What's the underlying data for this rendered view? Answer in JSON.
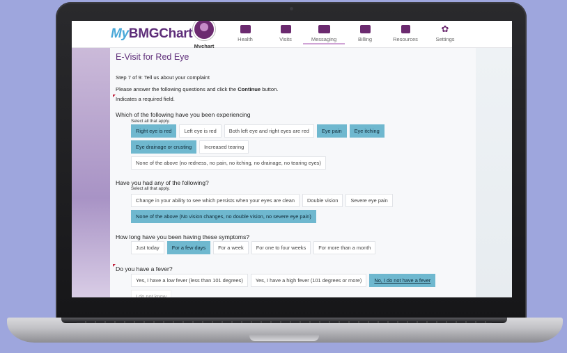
{
  "app": {
    "logo_prefix": "My",
    "logo_name": "BMGChart"
  },
  "nav": [
    {
      "label": "Mychart",
      "icon": "avatar-icon",
      "active": true
    },
    {
      "label": "Health",
      "icon": "folder-heart-icon"
    },
    {
      "label": "Visits",
      "icon": "briefcase-icon"
    },
    {
      "label": "Messaging",
      "icon": "envelope-icon"
    },
    {
      "label": "Billing",
      "icon": "credit-card-icon"
    },
    {
      "label": "Resources",
      "icon": "bookmark-plus-icon"
    },
    {
      "label": "Settings",
      "icon": "gear-icon"
    }
  ],
  "page": {
    "title": "E-Visit for Red Eye",
    "step": "Step 7 of 9: Tell us about your complaint",
    "instruction_pre": "Please answer the following questions and click the ",
    "instruction_bold": "Continue",
    "instruction_post": " button.",
    "required_note": "Indicates a required field."
  },
  "q1": {
    "question": "Which of the following have you been experiencing",
    "hint": "Select all that apply.",
    "options_row1": [
      {
        "label": "Right eye is red",
        "selected": true
      },
      {
        "label": "Left eye is red",
        "selected": false
      },
      {
        "label": "Both left eye and right eyes are red",
        "selected": false
      },
      {
        "label": "Eye pain",
        "selected": true
      },
      {
        "label": "Eye itching",
        "selected": true
      }
    ],
    "options_row2": [
      {
        "label": "Eye drainage or crusting",
        "selected": true
      },
      {
        "label": "Increased tearing",
        "selected": false
      }
    ],
    "options_row3": [
      {
        "label": "None of the above (no redness, no pain, no itching, no drainage, no tearing eyes)",
        "selected": false
      }
    ]
  },
  "q2": {
    "question": "Have you had any of the following?",
    "hint": "Select all that apply.",
    "options_row1": [
      {
        "label": "Change in your ability to see which persists when your eyes are clean",
        "selected": false
      },
      {
        "label": "Double vision",
        "selected": false
      },
      {
        "label": "Severe eye pain",
        "selected": false
      }
    ],
    "options_row2": [
      {
        "label": "None of the above (No vision changes, no double vision, no severe eye pain)",
        "selected": true
      }
    ]
  },
  "q3": {
    "question": "How long have you been having these symptoms?",
    "options": [
      {
        "label": "Just today",
        "selected": false
      },
      {
        "label": "For a few days",
        "selected": true
      },
      {
        "label": "For a week",
        "selected": false
      },
      {
        "label": "For one to four weeks",
        "selected": false
      },
      {
        "label": "For more than a month",
        "selected": false
      }
    ]
  },
  "q4": {
    "question": "Do you have a fever?",
    "options": [
      {
        "label": "Yes, I have a low fever (less than 101 degrees)",
        "selected": false
      },
      {
        "label": "Yes, I have a high fever (101 degrees or more)",
        "selected": false
      },
      {
        "label": "No, I do not have a fever",
        "selected": true
      }
    ],
    "options_row2": [
      {
        "label": "I do not know",
        "selected": false
      }
    ]
  },
  "colors": {
    "brand": "#5e2d79",
    "selected": "#6fb8cf",
    "required": "#c0203b",
    "background": "#9ea6dd"
  }
}
